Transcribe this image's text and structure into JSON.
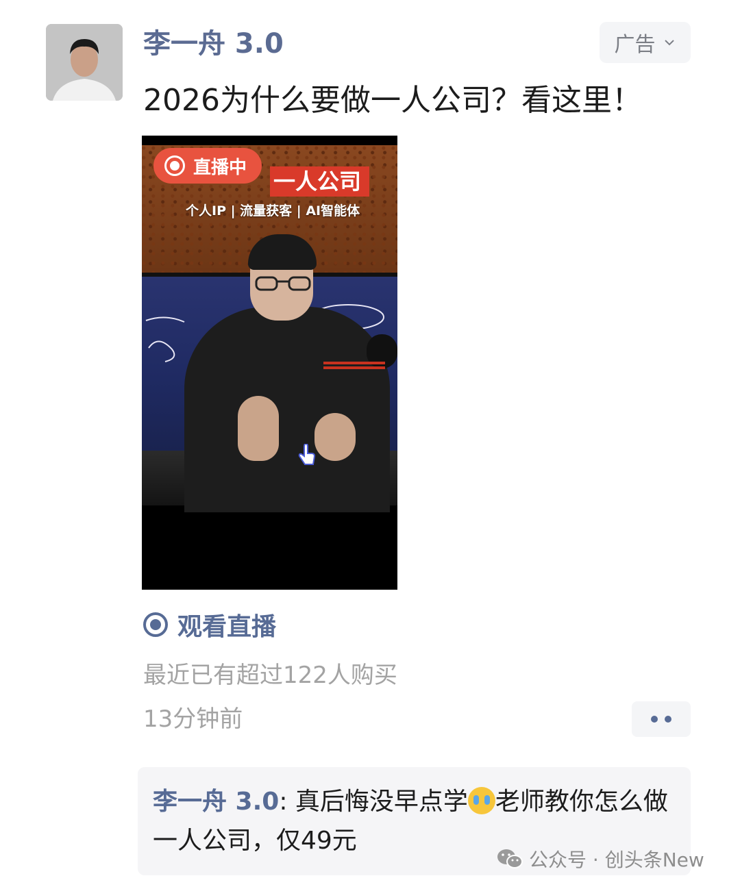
{
  "post": {
    "author": "李一舟 3.0",
    "ad_label": "广告",
    "title": "2026为什么要做一人公司？看这里！"
  },
  "video": {
    "live_badge": "直播中",
    "headline": "一人公司",
    "subline": "个人IP | 流量获客 | AI智能体"
  },
  "actions": {
    "watch_live": "观看直播",
    "purchase_note": "最近已有超过122人购买",
    "time_ago": "13分钟前"
  },
  "comment": {
    "author": "李一舟 3.0",
    "text_before_emoji": ": 真后悔没早点学",
    "text_after_emoji": "老师教你怎么做一人公司，仅49元"
  },
  "watermark": {
    "text": "公众号 · 创头条New"
  },
  "colors": {
    "link_blue": "#576b95",
    "live_red": "#e8533f",
    "muted_gray": "#a3a3a3"
  },
  "icons": {
    "ad_menu": "chevron-down-icon",
    "watch_live": "live-radio-icon",
    "more": "more-dots-icon",
    "watermark": "wechat-icon",
    "emoji": "crying-face-emoji"
  }
}
